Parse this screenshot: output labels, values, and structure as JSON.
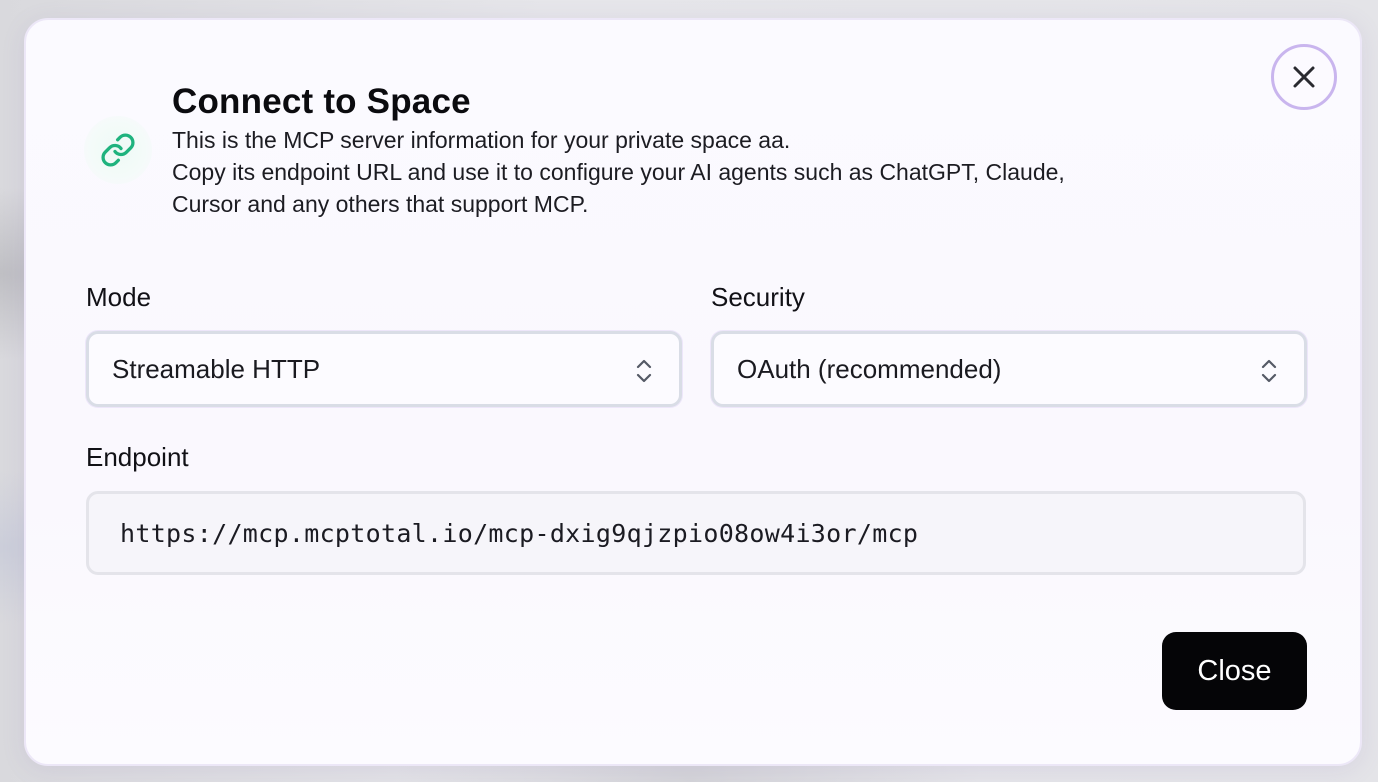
{
  "dialog": {
    "title": "Connect to Space",
    "description_lines": [
      "This is the MCP server information for your private space aa.",
      "Copy its endpoint URL and use it to configure your AI agents such as ChatGPT, Claude,",
      "Cursor and any others that support MCP."
    ],
    "header_icon": "link-icon",
    "close_icon": "close-icon"
  },
  "mode": {
    "label": "Mode",
    "selected": "Streamable HTTP"
  },
  "security": {
    "label": "Security",
    "selected": "OAuth (recommended)"
  },
  "endpoint": {
    "label": "Endpoint",
    "value": "https://mcp.mcptotal.io/mcp-dxig9qjzpio08ow4i3or/mcp"
  },
  "actions": {
    "close_label": "Close"
  },
  "colors": {
    "accent_ring": "#c9b5ee",
    "link_icon": "#1fb37e",
    "primary_button": "#050507"
  }
}
